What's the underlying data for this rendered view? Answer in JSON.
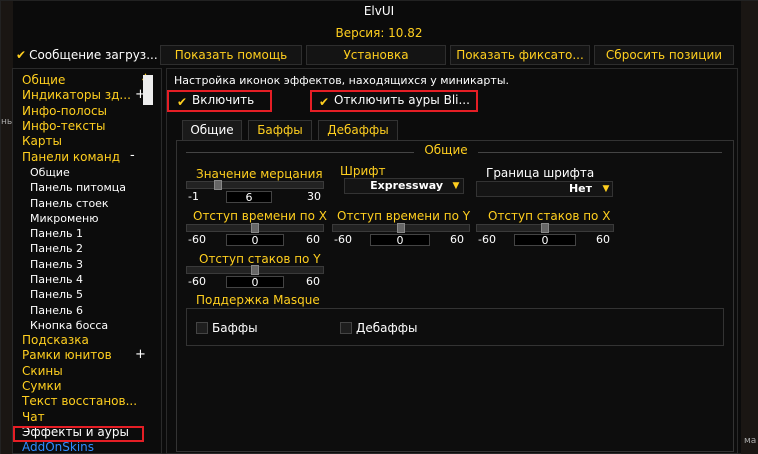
{
  "window": {
    "title": "ElvUI",
    "version": "Версия: 10.82"
  },
  "topbar": {
    "check_label": "Сообщение загруз...",
    "buttons": [
      "Показать помощь",
      "Установка",
      "Показать фиксато...",
      "Сбросить позиции"
    ]
  },
  "sidebar": {
    "items": [
      {
        "label": "Общие"
      },
      {
        "label": "Индикаторы зд..."
      },
      {
        "label": "Инфо-полосы"
      },
      {
        "label": "Инфо-тексты"
      },
      {
        "label": "Карты"
      },
      {
        "label": "Панели команд"
      },
      {
        "label": "Общие"
      },
      {
        "label": "Панель питомца"
      },
      {
        "label": "Панель стоек"
      },
      {
        "label": "Микроменю"
      },
      {
        "label": "Панель 1"
      },
      {
        "label": "Панель 2"
      },
      {
        "label": "Панель 3"
      },
      {
        "label": "Панель 4"
      },
      {
        "label": "Панель 5"
      },
      {
        "label": "Панель 6"
      },
      {
        "label": "Кнопка босса"
      },
      {
        "label": "Подсказка"
      },
      {
        "label": "Рамки юнитов"
      },
      {
        "label": "Скины"
      },
      {
        "label": "Сумки"
      },
      {
        "label": "Текст восстанов..."
      },
      {
        "label": "Чат"
      },
      {
        "label": "Эффекты и ауры"
      },
      {
        "label": "AddOnSkins"
      }
    ]
  },
  "main": {
    "description": "Настройка иконок эффектов, находящихся у миникарты.",
    "enable_label": "Включить",
    "disable_blizz_label": "Отключить ауры Bli...",
    "tabs": [
      "Общие",
      "Баффы",
      "Дебаффы"
    ],
    "group_title": "Общие",
    "flash": {
      "label": "Значение мерцания",
      "min": "-1",
      "value": "6",
      "max": "30"
    },
    "font": {
      "label": "Шрифт",
      "value": "Expressway"
    },
    "font_outline": {
      "label": "Граница шрифта",
      "value": "Нет"
    },
    "time_x": {
      "label": "Отступ времени по X",
      "min": "-60",
      "value": "0",
      "max": "60"
    },
    "time_y": {
      "label": "Отступ времени по Y",
      "min": "-60",
      "value": "0",
      "max": "60"
    },
    "count_x": {
      "label": "Отступ стаков по X",
      "min": "-60",
      "value": "0",
      "max": "60"
    },
    "count_y": {
      "label": "Отступ стаков по Y",
      "min": "-60",
      "value": "0",
      "max": "60"
    },
    "masque": {
      "label": "Поддержка Masque",
      "buffs": "Баффы",
      "debuffs": "Дебаффы"
    }
  },
  "background_glyphs": [
    "ны",
    "ма"
  ],
  "colors": {
    "accent": "#ffcf1f",
    "highlight": "#e51e25",
    "link": "#2e8cff"
  }
}
